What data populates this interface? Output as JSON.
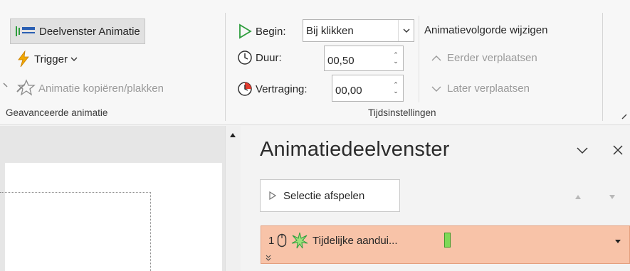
{
  "ribbon": {
    "advanced_group": {
      "label": "Geavanceerde animatie",
      "animation_pane_button": "Deelvenster Animatie",
      "trigger_button": "Trigger",
      "copy_animation_button": "Animatie kopiëren/plakken"
    },
    "timing_group": {
      "label": "Tijdsinstellingen",
      "start_label": "Begin:",
      "start_value": "Bij klikken",
      "duration_label": "Duur:",
      "duration_value": "00,50",
      "delay_label": "Vertraging:",
      "delay_value": "00,00",
      "reorder_title": "Animatievolgorde wijzigen",
      "move_earlier": "Eerder verplaatsen",
      "move_later": "Later verplaatsen"
    },
    "accent_colors": {
      "trigger": "#f2a900",
      "play": "#2e9d3d",
      "delay_badge": "#e23b2e"
    }
  },
  "animation_pane": {
    "title": "Animatiedeelvenster",
    "play_selection_button": "Selectie afspelen",
    "items": [
      {
        "index": "1",
        "name": "Tijdelijke aandui...",
        "trigger_icon": "mouse-icon",
        "effect_icon": "star-burst-icon",
        "bar_color": "#7ed957"
      }
    ],
    "item_bg_color": "#f8c3a8"
  }
}
